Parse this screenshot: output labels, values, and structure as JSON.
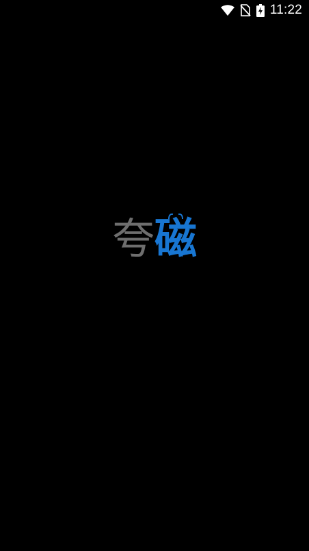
{
  "status_bar": {
    "time": "11:22",
    "icons": [
      "wifi-icon",
      "no-sim-icon",
      "battery-charging-icon"
    ]
  },
  "logo": {
    "char1": "夸",
    "char2": "磁",
    "char1_color": "#6e6e6e",
    "char2_color": "#1876d2"
  },
  "colors": {
    "background": "#000000",
    "status_text": "#ffffff"
  }
}
